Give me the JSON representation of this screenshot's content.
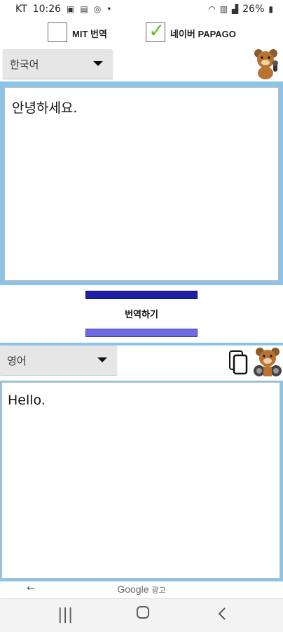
{
  "status_bar": {
    "carrier": "KT",
    "time": "10:26",
    "battery": "26%"
  },
  "engine_options": [
    {
      "label": "MIT 번역",
      "checked": false
    },
    {
      "label": "네이버 PAPAGO",
      "checked": true
    }
  ],
  "source": {
    "language": "한국어",
    "text": "안녕하세요."
  },
  "translate_label": "번역하기",
  "target": {
    "language": "영어",
    "text": "Hello."
  },
  "ad": {
    "brand": "Google",
    "tag": "광고"
  },
  "colors": {
    "panel_border": "#8cc4e8",
    "button_bar": "#1f1fa8",
    "check": "#5fbf2a"
  },
  "icons": {
    "recents": "recents-icon",
    "home": "home-icon",
    "back": "back-icon"
  }
}
